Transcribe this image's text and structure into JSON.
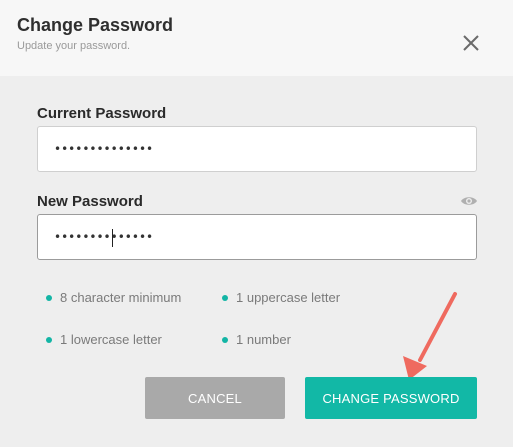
{
  "dialog": {
    "title": "Change Password",
    "subtitle": "Update your password."
  },
  "fields": {
    "current": {
      "label": "Current Password",
      "value": "••••••••••••••"
    },
    "new": {
      "label": "New Password",
      "value": "••••••••••••••"
    }
  },
  "requirements": [
    "8 character minimum",
    "1 uppercase letter",
    "1 lowercase letter",
    "1 number"
  ],
  "buttons": {
    "cancel": "CANCEL",
    "change": "CHANGE PASSWORD"
  },
  "colors": {
    "accent": "#12b8a6",
    "cancel": "#a9a9a9",
    "annotation_arrow": "#ef6a5f"
  },
  "icons": {
    "close": "close-icon",
    "toggle_visibility": "eye-icon",
    "bullet": "dot-icon",
    "annotation": "arrow-icon"
  }
}
